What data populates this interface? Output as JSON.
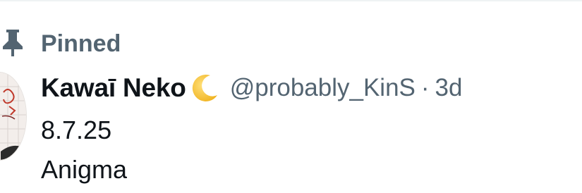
{
  "pinned": {
    "label": "Pinned",
    "icon": "pin-icon"
  },
  "tweet": {
    "display_name": "Kawaī Neko",
    "name_emoji_icon": "crescent-moon-icon",
    "handle": "@probably_KinS",
    "separator": "·",
    "timestamp": "3d",
    "text_lines": [
      "8.7.25",
      "Anigma"
    ]
  },
  "colors": {
    "primary_text": "#0f1419",
    "secondary_text": "#536471",
    "divider": "#eff3f4",
    "moon": "#f4c430"
  }
}
